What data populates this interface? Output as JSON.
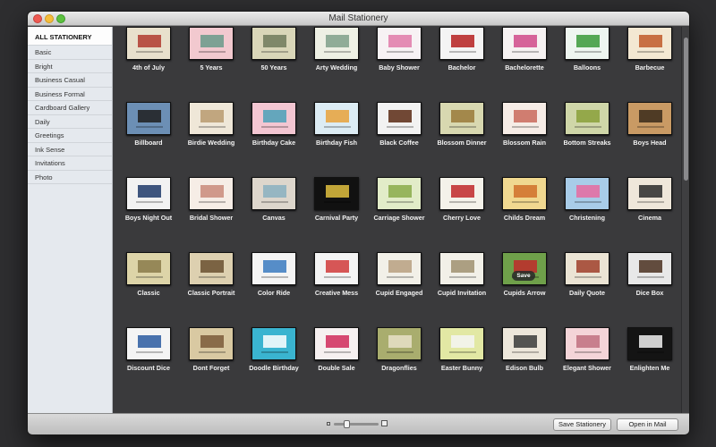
{
  "window": {
    "title": "Mail Stationery"
  },
  "sidebar": {
    "items": [
      {
        "label": "ALL STATIONERY",
        "selected": true
      },
      {
        "label": "Basic"
      },
      {
        "label": "Bright"
      },
      {
        "label": "Business Casual"
      },
      {
        "label": "Business Formal"
      },
      {
        "label": "Cardboard Gallery"
      },
      {
        "label": "Daily"
      },
      {
        "label": "Greetings"
      },
      {
        "label": "Ink Sense"
      },
      {
        "label": "Invitations"
      },
      {
        "label": "Photo"
      }
    ]
  },
  "stationery": [
    {
      "label": "4th of July",
      "bg": "#e8e0cc",
      "accent": "#b03a2e"
    },
    {
      "label": "5 Years",
      "bg": "#f2c9cf",
      "accent": "#6a9a8a"
    },
    {
      "label": "50 Years",
      "bg": "#d9d6b8",
      "accent": "#6e7a5a"
    },
    {
      "label": "Arty Wedding",
      "bg": "#eef0e4",
      "accent": "#7fa08a"
    },
    {
      "label": "Baby Shower",
      "bg": "#f7f2f4",
      "accent": "#e07aa8"
    },
    {
      "label": "Bachelor",
      "bg": "#f4f4f4",
      "accent": "#b52020"
    },
    {
      "label": "Bachelorette",
      "bg": "#f6f2f2",
      "accent": "#d04a8a"
    },
    {
      "label": "Balloons",
      "bg": "#eef6f0",
      "accent": "#3a9a3a"
    },
    {
      "label": "Barbecue",
      "bg": "#f3e8d2",
      "accent": "#c05a2a"
    },
    {
      "label": "Billboard",
      "bg": "#6c8fb5",
      "accent": "#1e1e1e"
    },
    {
      "label": "Birdie Wedding",
      "bg": "#efe7d8",
      "accent": "#b89a70"
    },
    {
      "label": "Birthday Cake",
      "bg": "#f3c6d2",
      "accent": "#4aa0b8"
    },
    {
      "label": "Birthday Fish",
      "bg": "#dcecf4",
      "accent": "#e8a23a"
    },
    {
      "label": "Black Coffee",
      "bg": "#f2f2f2",
      "accent": "#5a2a14"
    },
    {
      "label": "Blossom Dinner",
      "bg": "#d8d8b0",
      "accent": "#9a7a3a"
    },
    {
      "label": "Blossom Rain",
      "bg": "#f6ece6",
      "accent": "#c96a5a"
    },
    {
      "label": "Bottom Streaks",
      "bg": "#cfd6a8",
      "accent": "#8aa03a"
    },
    {
      "label": "Boys Head",
      "bg": "#c99a64",
      "accent": "#3a2a1a"
    },
    {
      "label": "Boys Night Out",
      "bg": "#f2f2f2",
      "accent": "#1e3a6a"
    },
    {
      "label": "Bridal Shower",
      "bg": "#f6ede6",
      "accent": "#c98a7a"
    },
    {
      "label": "Canvas",
      "bg": "#ddd6cc",
      "accent": "#8ab0c0"
    },
    {
      "label": "Carnival Party",
      "bg": "#111111",
      "accent": "#e0c040"
    },
    {
      "label": "Carriage Shower",
      "bg": "#e2ecc8",
      "accent": "#8aac4a"
    },
    {
      "label": "Cherry Love",
      "bg": "#f4f2ea",
      "accent": "#c0282a"
    },
    {
      "label": "Childs Dream",
      "bg": "#f0d890",
      "accent": "#d0702a"
    },
    {
      "label": "Christening",
      "bg": "#a8cce8",
      "accent": "#e66aa0"
    },
    {
      "label": "Cinema",
      "bg": "#efe7da",
      "accent": "#2a2a2a"
    },
    {
      "label": "Classic",
      "bg": "#ddd4a8",
      "accent": "#8a7a4a"
    },
    {
      "label": "Classic Portrait",
      "bg": "#ddd0b0",
      "accent": "#6a5030"
    },
    {
      "label": "Color Ride",
      "bg": "#f4f4f4",
      "accent": "#3a7ac0"
    },
    {
      "label": "Creative Mess",
      "bg": "#f4f4f4",
      "accent": "#d03a3a"
    },
    {
      "label": "Cupid Engaged",
      "bg": "#f2f0e8",
      "accent": "#b8a080"
    },
    {
      "label": "Cupid Invitation",
      "bg": "#f2f0e8",
      "accent": "#a09070"
    },
    {
      "label": "Cupids Arrow",
      "bg": "#6fa04a",
      "accent": "#c02a2a",
      "save": "Save"
    },
    {
      "label": "Daily Quote",
      "bg": "#ebe4d4",
      "accent": "#a0402a"
    },
    {
      "label": "Dice Box",
      "bg": "#e8e8e8",
      "accent": "#4a3020"
    },
    {
      "label": "Discount Dice",
      "bg": "#f4f4f4",
      "accent": "#2a5aa0"
    },
    {
      "label": "Dont Forget",
      "bg": "#d9c9a2",
      "accent": "#7a5a3a"
    },
    {
      "label": "Doodle Birthday",
      "bg": "#3ab4d0",
      "accent": "#ffffff"
    },
    {
      "label": "Double Sale",
      "bg": "#f6f0f0",
      "accent": "#d02a5a"
    },
    {
      "label": "Dragonflies",
      "bg": "#a9ad6e",
      "accent": "#e8e0c8"
    },
    {
      "label": "Easter Bunny",
      "bg": "#e2e8a4",
      "accent": "#f4f4f4"
    },
    {
      "label": "Edison Bulb",
      "bg": "#ece6da",
      "accent": "#3a3a3a"
    },
    {
      "label": "Elegant Shower",
      "bg": "#f4d4d8",
      "accent": "#c07080"
    },
    {
      "label": "Enlighten Me",
      "bg": "#141414",
      "accent": "#f0f0f0"
    }
  ],
  "zoom": {
    "level": 0.25
  },
  "buttons": {
    "save": "Save Stationery",
    "open": "Open in Mail"
  }
}
